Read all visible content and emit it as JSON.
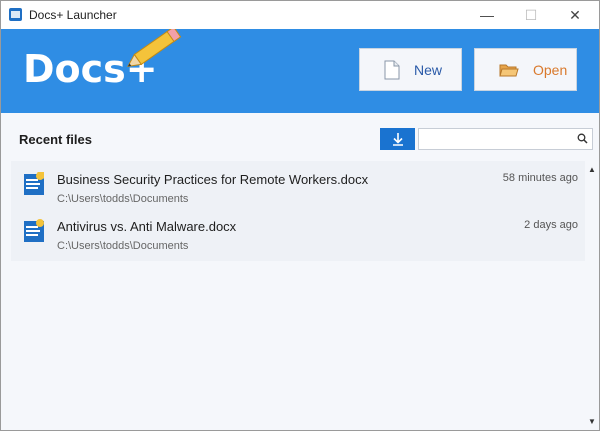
{
  "window": {
    "title": "Docs+ Launcher",
    "minimize": "—",
    "maximize": "☐",
    "close": "✕"
  },
  "header": {
    "logo": "Docs+",
    "new_label": "New",
    "open_label": "Open",
    "colors": {
      "banner": "#2f8de4",
      "new_text": "#2a5aa8",
      "open_text": "#d9792c"
    }
  },
  "recent": {
    "title": "Recent files",
    "search_value": "",
    "files": [
      {
        "name": "Business Security Practices for Remote Workers.docx",
        "path": "C:\\Users\\todds\\Documents",
        "time": "58 minutes ago"
      },
      {
        "name": "Antivirus vs. Anti Malware.docx",
        "path": "C:\\Users\\todds\\Documents",
        "time": "2 days ago"
      }
    ]
  },
  "icons": {
    "app": "docs-app-icon",
    "pencil": "pencil-icon",
    "new": "new-document-icon",
    "open": "open-folder-icon",
    "download": "download-arrow-icon",
    "search": "search-icon",
    "file": "word-document-icon"
  }
}
